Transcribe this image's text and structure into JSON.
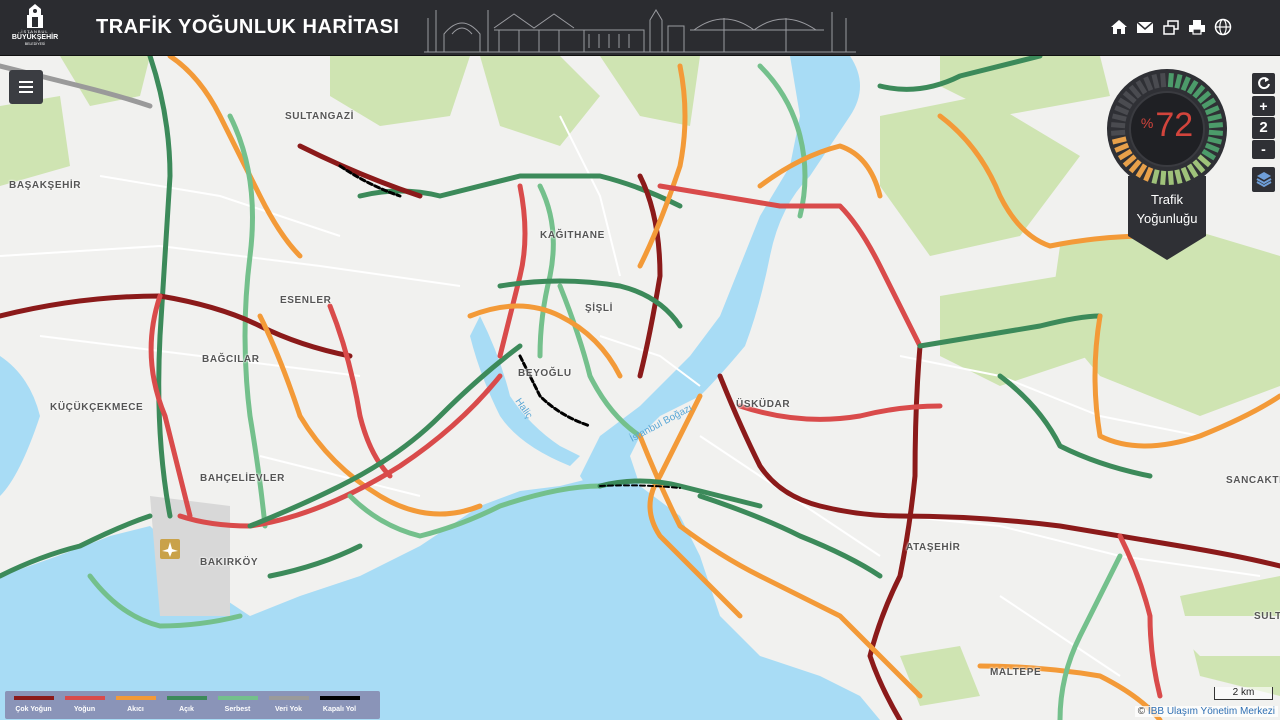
{
  "header": {
    "title": "TRAFİK YOĞUNLUK HARİTASI",
    "logo_line1": "İSTANBUL",
    "logo_line2": "BÜYÜKŞEHİR",
    "logo_line3": "BELEDİYESİ",
    "icons": [
      "home-icon",
      "mail-icon",
      "windows-icon",
      "print-icon",
      "globe-icon"
    ]
  },
  "map": {
    "places": [
      "SULTANGAZİ",
      "BAŞAKŞEHİR",
      "KAĞITHANE",
      "ESENLER",
      "ŞİŞLİ",
      "BAĞCILAR",
      "BEYOĞLU",
      "KÜÇÜKÇEKMECE",
      "ÜSKÜDAR",
      "BAHÇELİEVLER",
      "ATAŞEHİR",
      "BAKIRKÖY",
      "SANCAKTE",
      "SULT",
      "MALTEPE"
    ],
    "water_labels": [
      "İstanbul Boğazı",
      "Haliç"
    ],
    "colors": {
      "water": "#a8dcf5",
      "land": "#f1f1ef",
      "green": "#cfe4b2"
    }
  },
  "gauge": {
    "value": 72,
    "percent_sign": "%",
    "label_line1": "Trafik",
    "label_line2": "Yoğunluğu",
    "accent": "#d2443c"
  },
  "controls": {
    "refresh_icon": "refresh-icon",
    "zoom_in": "+",
    "zoom_level": "2",
    "zoom_out": "-",
    "layers_icon": "layers-icon"
  },
  "legend": {
    "items": [
      {
        "label": "Çok Yoğun",
        "color": "#8b1a1a"
      },
      {
        "label": "Yoğun",
        "color": "#d94b4b"
      },
      {
        "label": "Akıcı",
        "color": "#f39a38"
      },
      {
        "label": "Açık",
        "color": "#3c8a5a"
      },
      {
        "label": "Serbest",
        "color": "#74c08c"
      },
      {
        "label": "Veri Yok",
        "color": "#9a9a9a"
      },
      {
        "label": "Kapalı Yol",
        "color": "#000000"
      }
    ]
  },
  "scale_label": "2 km",
  "attribution": {
    "prefix": "©",
    "link": "İBB Ulaşım Yönetim Merkezi"
  }
}
